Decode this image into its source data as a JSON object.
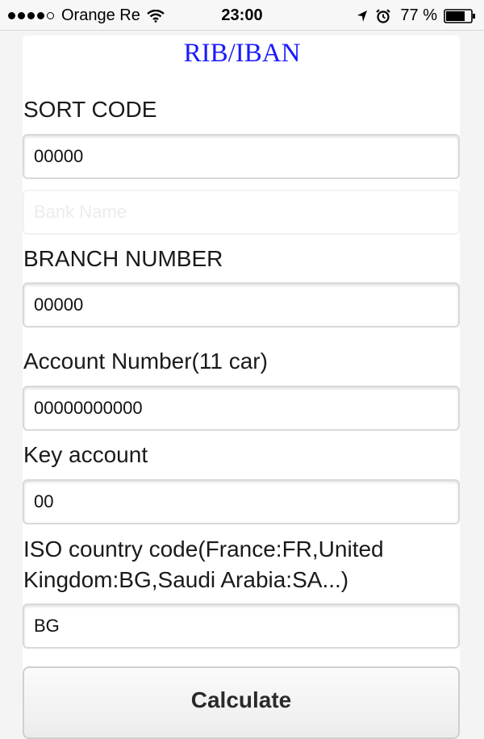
{
  "status_bar": {
    "carrier": "Orange Re",
    "time": "23:00",
    "battery": "77 %"
  },
  "form": {
    "title": "RIB/IBAN",
    "sort_code": {
      "label": "SORT CODE",
      "value": "00000"
    },
    "bank_name": {
      "placeholder": "Bank Name"
    },
    "branch_number": {
      "label": "BRANCH NUMBER",
      "value": "00000"
    },
    "account_number": {
      "label": "Account Number(11 car)",
      "value": "00000000000"
    },
    "key_account": {
      "label": "Key account",
      "value": "00"
    },
    "iso_country": {
      "label_line1": "ISO country code(France:FR,United",
      "label_line2": "Kingdom:BG,Saudi Arabia:SA...)",
      "value": "BG"
    },
    "calculate_label": "Calculate"
  }
}
